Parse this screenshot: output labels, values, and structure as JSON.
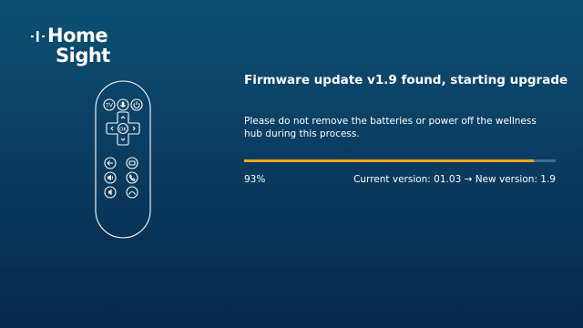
{
  "logo": {
    "line1": "Home",
    "line2": "Sight"
  },
  "remote": {
    "tv_label": "TV",
    "ok_label": "OK"
  },
  "update": {
    "title": "Firmware update v1.9 found, starting upgrade",
    "message": "Please do not remove the batteries or power off the wellness hub during this process.",
    "progress": 0.93,
    "progress_text": "93%",
    "version_text": "Current version: 01.03 → New version: 1.9"
  },
  "colors": {
    "accent": "#f0a71c",
    "track": "#3d6f8f",
    "background_top": "#0d4f74",
    "background_bottom": "#06284a"
  }
}
